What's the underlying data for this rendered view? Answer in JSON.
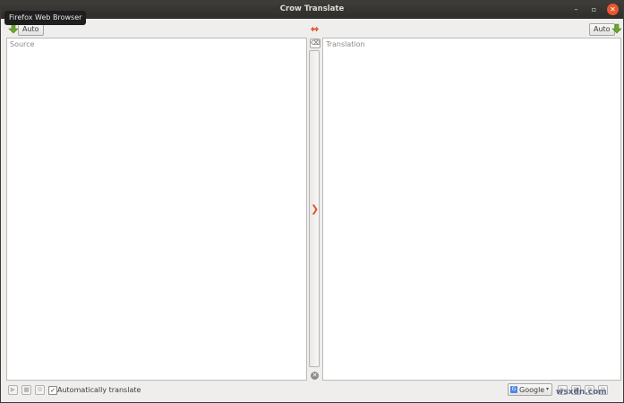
{
  "window": {
    "title": "Crow Translate",
    "minimize_glyph": "–",
    "maximize_glyph": "▫",
    "close_glyph": "✕"
  },
  "tooltip": {
    "text": "Firefox Web Browser"
  },
  "source": {
    "language_button": "Auto",
    "placeholder": "Source",
    "speak_icon": "arrow-down-green-icon"
  },
  "translation": {
    "language_button": "Auto",
    "placeholder": "Translation",
    "speak_icon": "arrow-down-green-icon"
  },
  "center": {
    "swap_icon": "swap-arrows-icon",
    "clear_glyph": "⌫",
    "translate_glyph": "❯",
    "stop_glyph": "✕"
  },
  "bottom": {
    "auto_translate_label": "Automatically translate",
    "auto_translate_checked": "✓",
    "play_glyph": "▶",
    "stop_glyph": "■",
    "copy_glyph": "⧉",
    "engine": "Google",
    "engine_caret": "▾",
    "engine_icon_glyph": "G",
    "watermark": "wsxdn.com"
  },
  "colors": {
    "accent_orange": "#e2572c",
    "close_button": "#e9572e",
    "titlebar": "#3e3d39",
    "green_icon": "#6aa62f"
  }
}
